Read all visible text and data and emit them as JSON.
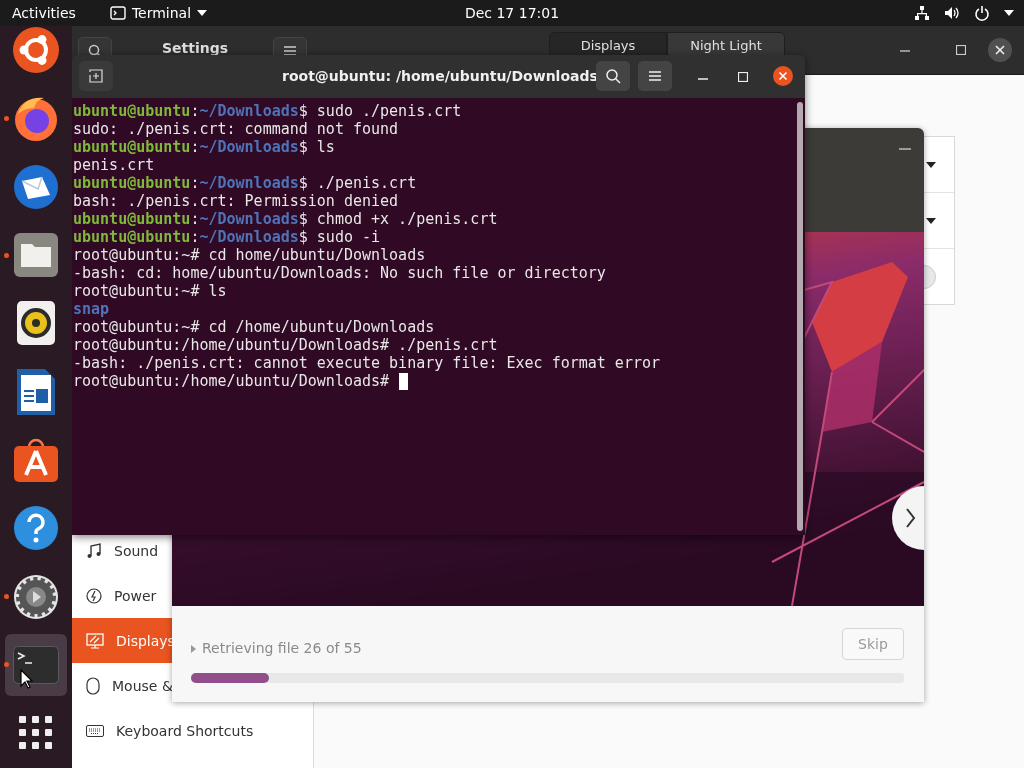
{
  "top_bar": {
    "activities": "Activities",
    "app_menu": "Terminal",
    "clock": "Dec 17  17:01"
  },
  "dock": [
    {
      "kind": "ubuntu",
      "running": false,
      "selected": false
    },
    {
      "kind": "firefox",
      "running": true,
      "selected": false
    },
    {
      "kind": "mail",
      "running": false,
      "selected": false
    },
    {
      "kind": "files",
      "running": true,
      "selected": false
    },
    {
      "kind": "music",
      "running": false,
      "selected": false
    },
    {
      "kind": "writer",
      "running": false,
      "selected": false
    },
    {
      "kind": "store",
      "running": false,
      "selected": false
    },
    {
      "kind": "help",
      "running": false,
      "selected": false
    },
    {
      "kind": "gear",
      "running": true,
      "selected": false
    },
    {
      "kind": "terminal",
      "running": true,
      "selected": true
    },
    {
      "kind": "grid",
      "running": false,
      "selected": false
    }
  ],
  "settings": {
    "title": "Settings",
    "tabs": [
      {
        "label": "Displays",
        "selected": true
      },
      {
        "label": "Night Light",
        "selected": false
      }
    ],
    "sidebar": [
      {
        "label": "Sound",
        "kind": "note",
        "selected": false
      },
      {
        "label": "Power",
        "kind": "power",
        "selected": false
      },
      {
        "label": "Displays",
        "kind": "display",
        "selected": true
      },
      {
        "label": "Mouse &",
        "kind": "mouse",
        "selected": false
      },
      {
        "label": "Keyboard Shortcuts",
        "kind": "keyboard",
        "selected": false
      }
    ]
  },
  "terminal": {
    "title": "root@ubuntu: /home/ubuntu/Downloads",
    "lines": [
      {
        "kind": "prompt",
        "user": "ubuntu@ubuntu",
        "sep": ":",
        "path": "~/Downloads",
        "command": "$ sudo ./penis.crt"
      },
      {
        "kind": "output",
        "text": "sudo: ./penis.crt: command not found"
      },
      {
        "kind": "prompt",
        "user": "ubuntu@ubuntu",
        "sep": ":",
        "path": "~/Downloads",
        "command": "$ ls"
      },
      {
        "kind": "output",
        "text": "penis.crt"
      },
      {
        "kind": "prompt",
        "user": "ubuntu@ubuntu",
        "sep": ":",
        "path": "~/Downloads",
        "command": "$ ./penis.crt"
      },
      {
        "kind": "output",
        "text": "bash: ./penis.crt: Permission denied"
      },
      {
        "kind": "prompt",
        "user": "ubuntu@ubuntu",
        "sep": ":",
        "path": "~/Downloads",
        "command": "$ chmod +x ./penis.crt"
      },
      {
        "kind": "prompt",
        "user": "ubuntu@ubuntu",
        "sep": ":",
        "path": "~/Downloads",
        "command": "$ sudo -i"
      },
      {
        "kind": "output",
        "text": "root@ubuntu:~# cd home/ubuntu/Downloads"
      },
      {
        "kind": "output",
        "text": "-bash: cd: home/ubuntu/Downloads: No such file or directory"
      },
      {
        "kind": "output",
        "text": "root@ubuntu:~# ls"
      },
      {
        "kind": "directory",
        "text": "snap"
      },
      {
        "kind": "output",
        "text": "root@ubuntu:~# cd /home/ubuntu/Downloads"
      },
      {
        "kind": "output",
        "text": "root@ubuntu:/home/ubuntu/Downloads# ./penis.crt"
      },
      {
        "kind": "output",
        "text": "-bash: ./penis.crt: cannot execute binary file: Exec format error"
      },
      {
        "kind": "output",
        "text": "root@ubuntu:/home/ubuntu/Downloads#",
        "cursor": true
      }
    ]
  },
  "dialog": {
    "status": "Retrieving file 26 of 55",
    "skip": {
      "label": "Skip",
      "disabled": true
    },
    "progress": {
      "level": 0.11
    }
  }
}
